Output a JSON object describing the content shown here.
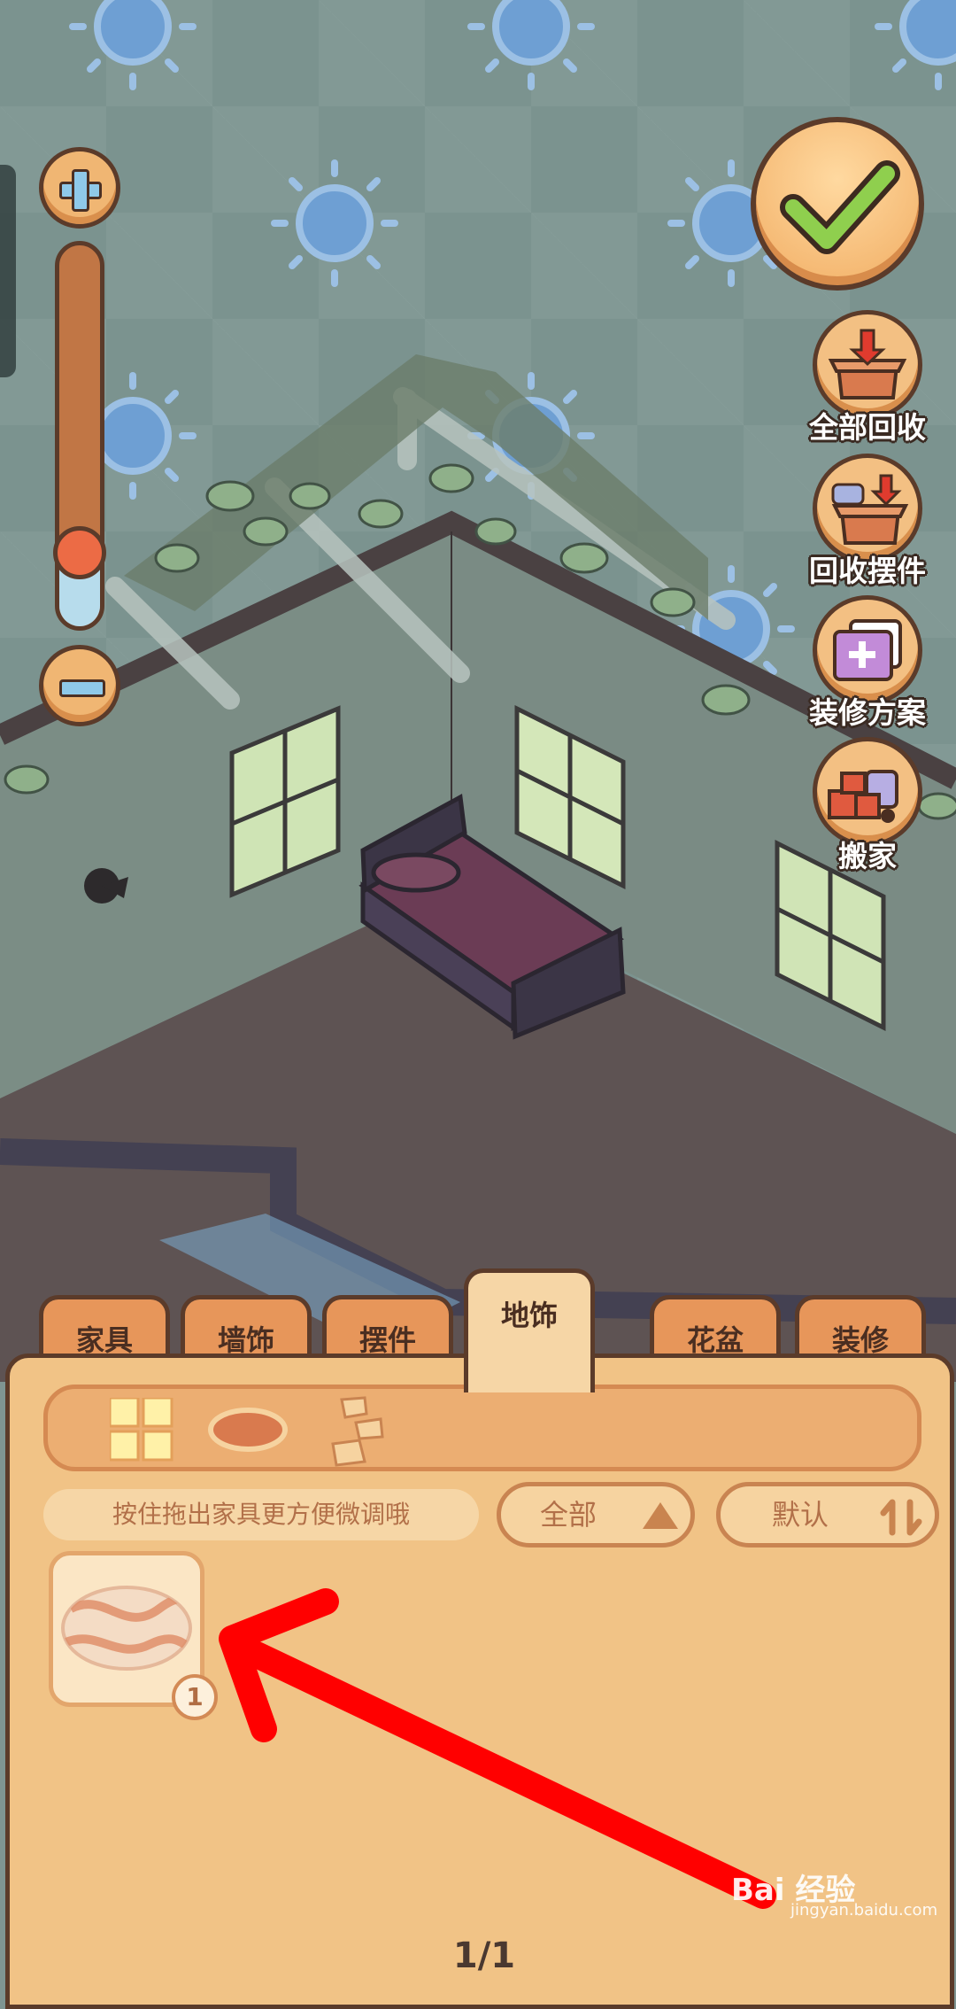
{
  "zoom": {
    "level": 0.2,
    "plus_icon": "plus-icon",
    "minus_icon": "minus-icon"
  },
  "confirm": {
    "icon": "checkmark-icon"
  },
  "side_actions": [
    {
      "label": "全部回收",
      "icon": "box-recycle-icon"
    },
    {
      "label": "回收摆件",
      "icon": "recycle-ornament-icon"
    },
    {
      "label": "装修方案",
      "icon": "decoration-plan-icon"
    },
    {
      "label": "搬家",
      "icon": "moving-truck-icon"
    }
  ],
  "tabs": [
    {
      "label": "家具"
    },
    {
      "label": "墙饰"
    },
    {
      "label": "摆件"
    },
    {
      "label": "地饰"
    },
    {
      "label": "花盆"
    },
    {
      "label": "装修"
    }
  ],
  "active_tab": "地饰",
  "filter_icons": [
    "grid-tiles-icon",
    "oval-rug-icon",
    "stones-icon"
  ],
  "hint": "按住拖出家具更方便微调哦",
  "filter_pills": {
    "category": {
      "label": "全部",
      "icon": "triangle-up-icon"
    },
    "sort": {
      "label": "默认",
      "icon": "sort-icon"
    }
  },
  "items": [
    {
      "name": "marble oval rug",
      "count": "1"
    }
  ],
  "pagination": "1/1",
  "colors": {
    "panel": "#f1c386",
    "tab": "#e7965a",
    "outline": "#5b3b2a",
    "annotation_arrow": "#ff0000"
  },
  "watermark": {
    "brand": "Bai 经验",
    "url": "jingyan.baidu.com"
  }
}
